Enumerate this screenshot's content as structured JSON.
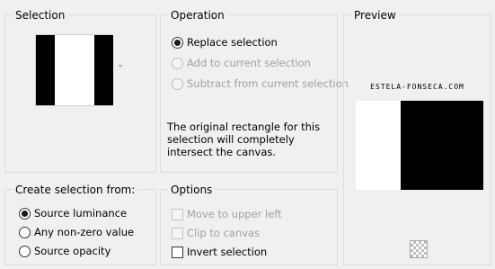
{
  "selection": {
    "title": "Selection",
    "dropdown_icon": "chevron-down-icon"
  },
  "operation": {
    "title": "Operation",
    "options": [
      {
        "label": "Replace selection",
        "checked": true,
        "enabled": true
      },
      {
        "label": "Add to current selection",
        "checked": false,
        "enabled": false
      },
      {
        "label": "Subtract from current selection",
        "checked": false,
        "enabled": false
      }
    ],
    "description": "The original rectangle for this selection will completely intersect the canvas."
  },
  "preview": {
    "title": "Preview",
    "watermark": "ESTELA-FONSECA.COM",
    "zoom_icon": "checkerboard-icon"
  },
  "create_from": {
    "title": "Create selection from:",
    "options": [
      {
        "label": "Source luminance",
        "checked": true
      },
      {
        "label": "Any non-zero value",
        "checked": false
      },
      {
        "label": "Source opacity",
        "checked": false
      }
    ]
  },
  "options": {
    "title": "Options",
    "items": [
      {
        "label": "Move to upper left",
        "checked": false,
        "enabled": false
      },
      {
        "label": "Clip to canvas",
        "checked": false,
        "enabled": false
      },
      {
        "label": "Invert selection",
        "checked": false,
        "enabled": true
      }
    ]
  }
}
